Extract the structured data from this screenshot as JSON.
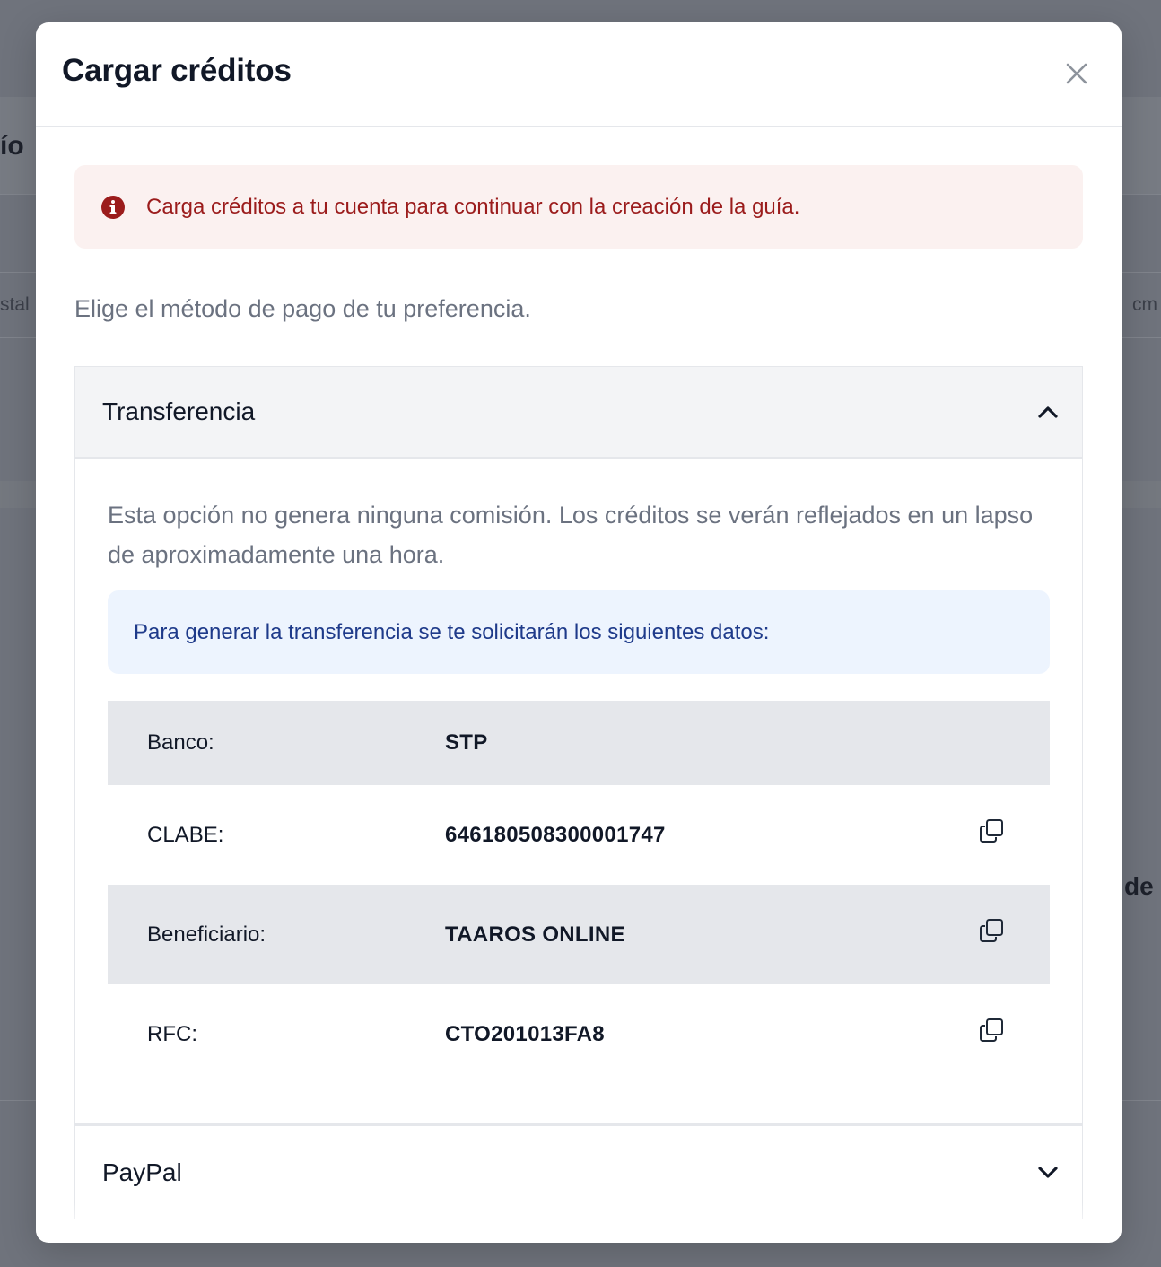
{
  "background": {
    "heading_fragment": "ío",
    "col_left_fragment": "stal",
    "col_right_fragment": "cm",
    "mid_right_fragment": "de"
  },
  "modal": {
    "title": "Cargar créditos",
    "close_icon": "close-icon"
  },
  "alert": {
    "icon": "info-circle-icon",
    "text": "Carga créditos a tu cuenta para continuar con la creación de la guía.",
    "color": "#9b1c1c",
    "background": "#fbf1f0"
  },
  "intro": "Elige el método de pago de tu preferencia.",
  "payment_methods": [
    {
      "title": "Transferencia",
      "expanded": true,
      "chevron": "chevron-up-icon",
      "description": "Esta opción no genera ninguna comisión. Los créditos se verán reflejados en un lapso de aproximadamente una hora.",
      "info": "Para generar la transferencia se te solicitarán los siguientes datos:",
      "rows": [
        {
          "label": "Banco:",
          "value": "STP",
          "copyable": false
        },
        {
          "label": "CLABE:",
          "value": "646180508300001747",
          "copyable": true
        },
        {
          "label": "Beneficiario:",
          "value": "TAAROS ONLINE",
          "copyable": true
        },
        {
          "label": "RFC:",
          "value": "CTO201013FA8",
          "copyable": true
        }
      ]
    },
    {
      "title": "PayPal",
      "expanded": false,
      "chevron": "chevron-down-icon"
    }
  ]
}
